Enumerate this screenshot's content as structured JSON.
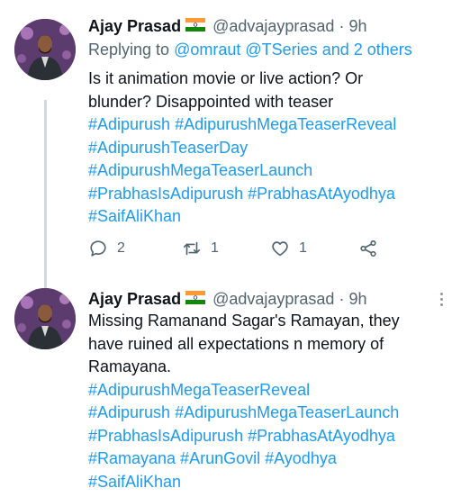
{
  "tweets": [
    {
      "name": "Ajay Prasad",
      "handle": "@advajayprasad",
      "dot": "·",
      "time": "9h",
      "replying_prefix": "Replying to",
      "replying_users": "@omraut @TSeries",
      "replying_and": "and",
      "replying_others": "2 others",
      "text_lines": [
        "Is it animation movie or live action? Or",
        "blunder? Disappointed with teaser"
      ],
      "hashtag_lines": [
        "#Adipurush #AdipurushMegaTeaserReveal",
        "#AdipurushTeaserDay",
        "#AdipurushMegaTeaserLaunch",
        "#PrabhasIsAdipurush #PrabhasAtAyodhya",
        "#SaifAliKhan"
      ],
      "reply_count": "2",
      "retweet_count": "1",
      "like_count": "1"
    },
    {
      "name": "Ajay Prasad",
      "handle": "@advajayprasad",
      "dot": "·",
      "time": "9h",
      "text_lines": [
        "Missing Ramanand Sagar's Ramayan, they",
        "have ruined all expectations n memory of",
        "Ramayana."
      ],
      "hashtag_lines": [
        "#AdipurushMegaTeaserReveal",
        "#Adipurush #AdipurushMegaTeaserLaunch",
        "#PrabhasIsAdipurush #PrabhasAtAyodhya",
        "#Ramayana #ArunGovil #Ayodhya",
        "#SaifAliKhan"
      ]
    }
  ],
  "icons": {
    "flag": "india-flag-icon",
    "reply": "reply-icon",
    "retweet": "retweet-icon",
    "like": "heart-icon",
    "share": "share-icon",
    "more": "more-icon"
  },
  "colors": {
    "link": "#1d9bf0",
    "muted": "#536471",
    "line": "#cfd9de"
  }
}
